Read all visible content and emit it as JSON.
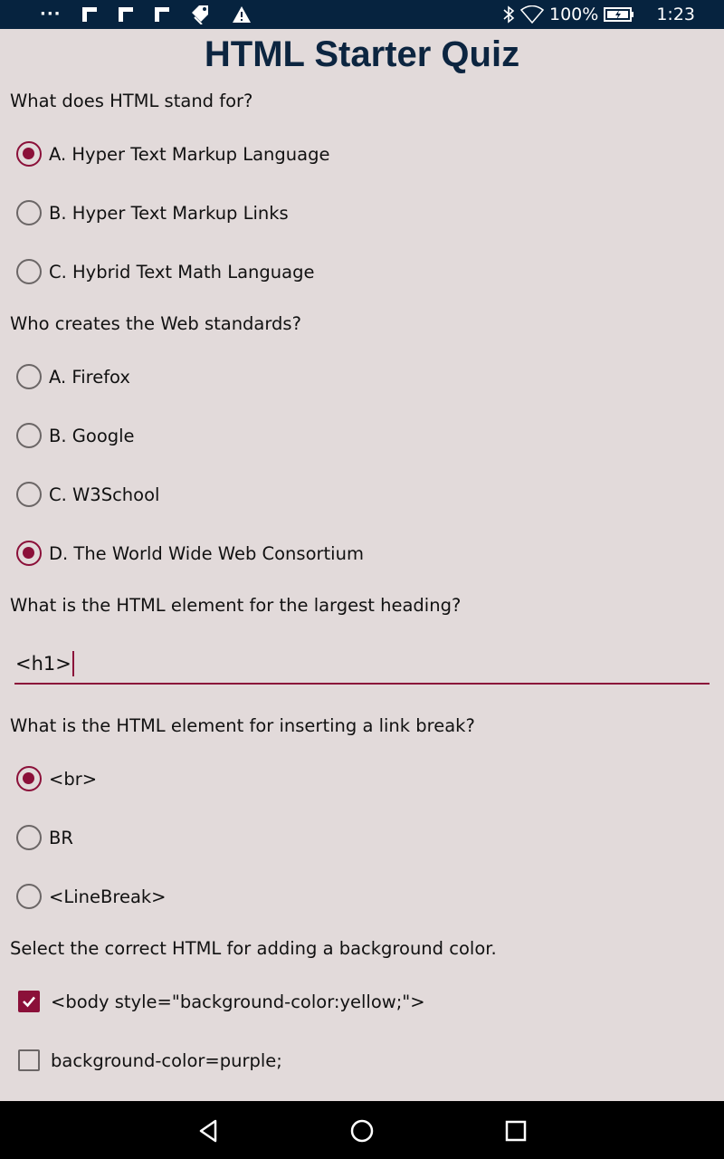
{
  "status_bar": {
    "battery": "100%",
    "time": "1:23",
    "icons": [
      "more-dots-icon",
      "flipboard-icon",
      "flipboard-icon",
      "flipboard-icon",
      "tag-icon",
      "warning-icon",
      "bluetooth-icon",
      "wifi-icon",
      "battery-icon"
    ]
  },
  "title": "HTML Starter Quiz",
  "questions": [
    {
      "text": "What does HTML stand for?",
      "type": "radio",
      "options": [
        {
          "label": "A. Hyper Text Markup Language",
          "checked": true
        },
        {
          "label": "B. Hyper Text Markup Links",
          "checked": false
        },
        {
          "label": "C. Hybrid Text Math Language",
          "checked": false
        }
      ]
    },
    {
      "text": "Who creates the Web standards?",
      "type": "radio",
      "options": [
        {
          "label": "A. Firefox",
          "checked": false
        },
        {
          "label": "B. Google",
          "checked": false
        },
        {
          "label": "C. W3School",
          "checked": false
        },
        {
          "label": "D. The World Wide Web Consortium",
          "checked": true
        }
      ]
    },
    {
      "text": "What is the HTML element for the largest heading?",
      "type": "text",
      "value": "<h1>"
    },
    {
      "text": "What is the HTML element for inserting a link break?",
      "type": "radio",
      "options": [
        {
          "label": "<br>",
          "checked": true
        },
        {
          "label": "BR",
          "checked": false
        },
        {
          "label": "<LineBreak>",
          "checked": false
        }
      ]
    },
    {
      "text": "Select the correct HTML for adding a background color.",
      "type": "checkbox",
      "options": [
        {
          "label": "<body style=\"background-color:yellow;\">",
          "checked": true
        },
        {
          "label": "background-color=purple;",
          "checked": false
        }
      ]
    }
  ],
  "colors": {
    "accent": "#8b1039",
    "status_bar": "#06233f",
    "background": "#e2dada",
    "title": "#0c2540"
  },
  "nav_bar": {
    "icons": [
      "back-icon",
      "home-icon",
      "recents-icon"
    ]
  }
}
